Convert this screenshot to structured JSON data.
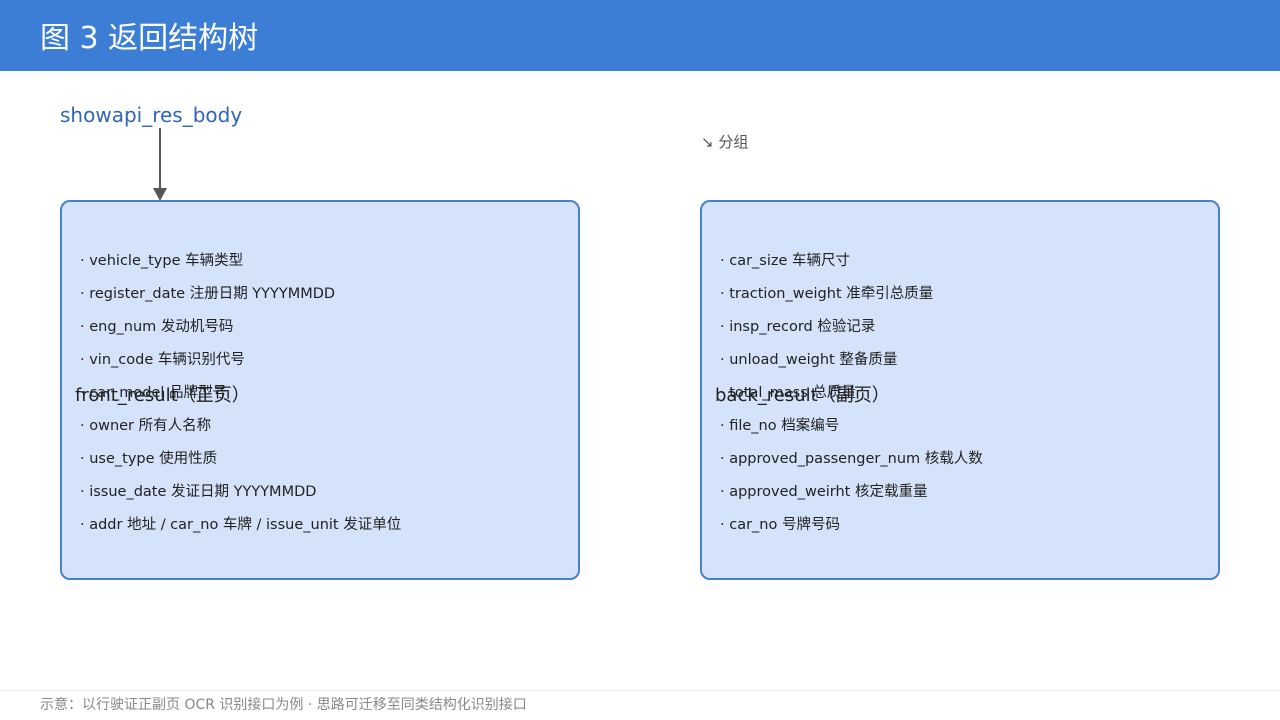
{
  "header": {
    "title": "图 3  返回结构树",
    "bg_color": "#3c7ed6"
  },
  "root": {
    "label": "showapi_res_body"
  },
  "group_note": "↘ 分组",
  "groups": [
    {
      "title": "front_result（正页）",
      "fields": [
        "· vehicle_type 车辆类型",
        "· register_date 注册日期 YYYYMMDD",
        "· eng_num 发动机号码",
        "· vin_code 车辆识别代号",
        "· car_model 品牌型号",
        "· owner 所有人名称",
        "· use_type 使用性质",
        "· issue_date 发证日期 YYYYMMDD",
        "· addr 地址 / car_no 车牌 / issue_unit 发证单位"
      ]
    },
    {
      "title": "back_result（副页）",
      "fields": [
        "· car_size 车辆尺寸",
        "· traction_weight 准牵引总质量",
        "· insp_record 检验记录",
        "· unload_weight 整备质量",
        "· total_mass 总质量",
        "· file_no 档案编号",
        "· approved_passenger_num 核载人数",
        "· approved_weirht 核定载重量",
        "· car_no 号牌号码"
      ]
    }
  ],
  "footer": "示意：以行驶证正副页 OCR 识别接口为例 · 思路可迁移至同类结构化识别接口",
  "colors": {
    "box_fill": "#d4e3fa",
    "box_border": "#4a7fce",
    "root_text": "#2f66b8"
  }
}
